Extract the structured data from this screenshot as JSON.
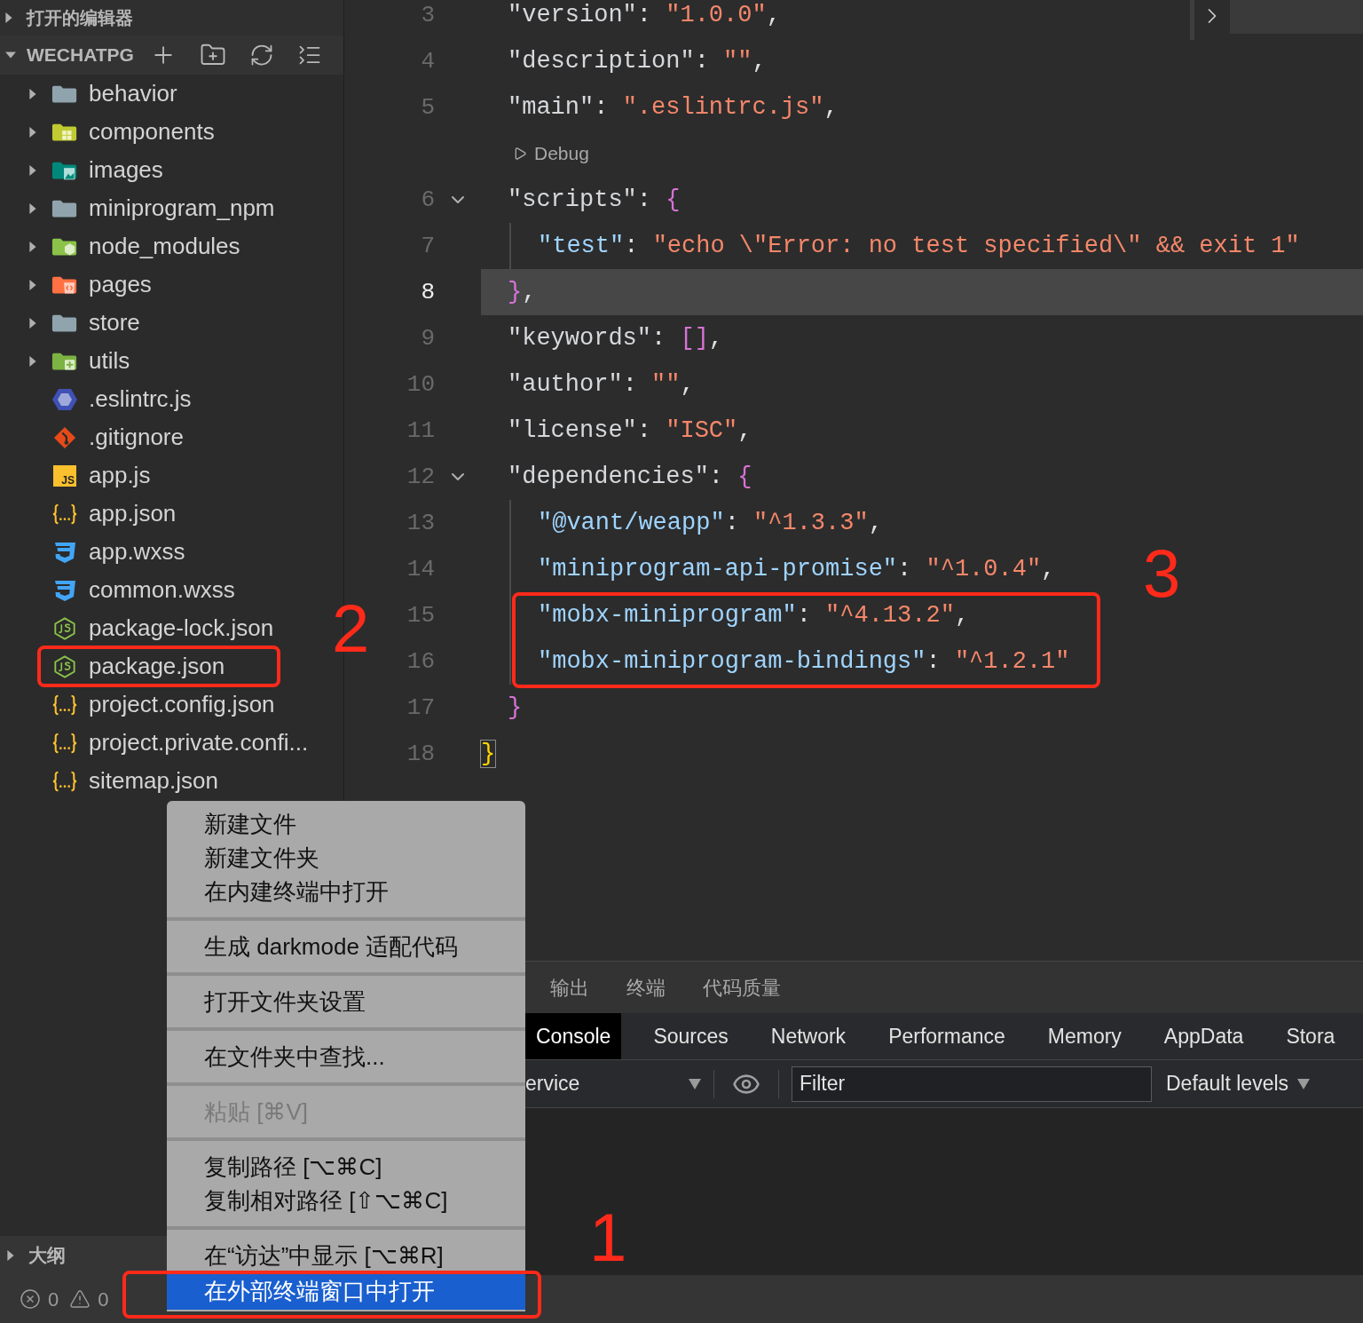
{
  "sidebar": {
    "open_editors": {
      "title": "打开的编辑器",
      "expanded": false
    },
    "explorer": {
      "title": "WECHATPG",
      "expanded": true,
      "items": [
        {
          "name": "behavior",
          "kind": "folder",
          "expanded": false
        },
        {
          "name": "components",
          "kind": "components",
          "expanded": false
        },
        {
          "name": "images",
          "kind": "images",
          "expanded": false
        },
        {
          "name": "miniprogram_npm",
          "kind": "folder",
          "expanded": false
        },
        {
          "name": "node_modules",
          "kind": "modules",
          "expanded": false
        },
        {
          "name": "pages",
          "kind": "pages",
          "expanded": false
        },
        {
          "name": "store",
          "kind": "folder",
          "expanded": false
        },
        {
          "name": "utils",
          "kind": "utils",
          "expanded": false
        },
        {
          "name": ".eslintrc.js",
          "kind": "eslint"
        },
        {
          "name": ".gitignore",
          "kind": "git"
        },
        {
          "name": "app.js",
          "kind": "script",
          "badge": "JS"
        },
        {
          "name": "app.json",
          "kind": "json"
        },
        {
          "name": "app.wxss",
          "kind": "css"
        },
        {
          "name": "common.wxss",
          "kind": "css"
        },
        {
          "name": "package-lock.json",
          "kind": "npm"
        },
        {
          "name": "package.json",
          "kind": "npm"
        },
        {
          "name": "project.config.json",
          "kind": "json"
        },
        {
          "name": "project.private.confi...",
          "kind": "json"
        },
        {
          "name": "sitemap.json",
          "kind": "json"
        }
      ]
    },
    "outline": {
      "title": "大纲",
      "expanded": false
    }
  },
  "editor": {
    "lines": [
      {
        "kind": "code",
        "number": "3",
        "current": false,
        "foldable": false,
        "tokens": [
          {
            "kind": "key",
            "text": "\"version\""
          },
          {
            "kind": "punct",
            "text": ": "
          },
          {
            "kind": "string",
            "text": "\"1.0.0\""
          },
          {
            "kind": "punct",
            "text": ","
          }
        ]
      },
      {
        "kind": "code",
        "number": "4",
        "current": false,
        "foldable": false,
        "tokens": [
          {
            "kind": "key",
            "text": "\"description\""
          },
          {
            "kind": "punct",
            "text": ": "
          },
          {
            "kind": "string",
            "text": "\"\""
          },
          {
            "kind": "punct",
            "text": ","
          }
        ]
      },
      {
        "kind": "code",
        "number": "5",
        "current": false,
        "foldable": false,
        "tokens": [
          {
            "kind": "key",
            "text": "\"main\""
          },
          {
            "kind": "punct",
            "text": ": "
          },
          {
            "kind": "string",
            "text": "\".eslintrc.js\""
          },
          {
            "kind": "punct",
            "text": ","
          }
        ]
      },
      {
        "kind": "codelens",
        "label": "Debug"
      },
      {
        "kind": "code",
        "number": "6",
        "current": false,
        "foldable": true,
        "tokens": [
          {
            "kind": "key",
            "text": "\"scripts\""
          },
          {
            "kind": "punct",
            "text": ": "
          },
          {
            "kind": "brace",
            "text": "{"
          }
        ]
      },
      {
        "kind": "nested",
        "number": "7",
        "current": false,
        "foldable": false,
        "tokens": [
          {
            "kind": "subkey",
            "text": "\"test\""
          },
          {
            "kind": "punct",
            "text": ": "
          },
          {
            "kind": "string",
            "text": "\"echo \\\"Error: no test specified\\\" && exit 1\""
          }
        ]
      },
      {
        "kind": "code",
        "number": "8",
        "current": true,
        "foldable": false,
        "tokens": [
          {
            "kind": "brace",
            "text": "}"
          },
          {
            "kind": "punct",
            "text": ","
          }
        ]
      },
      {
        "kind": "code",
        "number": "9",
        "current": false,
        "foldable": false,
        "tokens": [
          {
            "kind": "key",
            "text": "\"keywords\""
          },
          {
            "kind": "punct",
            "text": ": "
          },
          {
            "kind": "brace",
            "text": "[]"
          },
          {
            "kind": "punct",
            "text": ","
          }
        ]
      },
      {
        "kind": "code",
        "number": "10",
        "current": false,
        "foldable": false,
        "tokens": [
          {
            "kind": "key",
            "text": "\"author\""
          },
          {
            "kind": "punct",
            "text": ": "
          },
          {
            "kind": "string",
            "text": "\"\""
          },
          {
            "kind": "punct",
            "text": ","
          }
        ]
      },
      {
        "kind": "code",
        "number": "11",
        "current": false,
        "foldable": false,
        "tokens": [
          {
            "kind": "key",
            "text": "\"license\""
          },
          {
            "kind": "punct",
            "text": ": "
          },
          {
            "kind": "string",
            "text": "\"ISC\""
          },
          {
            "kind": "punct",
            "text": ","
          }
        ]
      },
      {
        "kind": "code",
        "number": "12",
        "current": false,
        "foldable": true,
        "tokens": [
          {
            "kind": "key",
            "text": "\"dependencies\""
          },
          {
            "kind": "punct",
            "text": ": "
          },
          {
            "kind": "brace",
            "text": "{"
          }
        ]
      },
      {
        "kind": "nested",
        "number": "13",
        "current": false,
        "foldable": false,
        "tokens": [
          {
            "kind": "subkey",
            "text": "\"@vant/weapp\""
          },
          {
            "kind": "punct",
            "text": ": "
          },
          {
            "kind": "string",
            "text": "\"^1.3.3\""
          },
          {
            "kind": "punct",
            "text": ","
          }
        ]
      },
      {
        "kind": "nested",
        "number": "14",
        "current": false,
        "foldable": false,
        "tokens": [
          {
            "kind": "subkey",
            "text": "\"miniprogram-api-promise\""
          },
          {
            "kind": "punct",
            "text": ": "
          },
          {
            "kind": "string",
            "text": "\"^1.0.4\""
          },
          {
            "kind": "punct",
            "text": ","
          }
        ]
      },
      {
        "kind": "nested",
        "number": "15",
        "current": false,
        "foldable": false,
        "tokens": [
          {
            "kind": "subkey",
            "text": "\"mobx-miniprogram\""
          },
          {
            "kind": "punct",
            "text": ": "
          },
          {
            "kind": "string",
            "text": "\"^4.13.2\""
          },
          {
            "kind": "punct",
            "text": ","
          }
        ]
      },
      {
        "kind": "nested",
        "number": "16",
        "current": false,
        "foldable": false,
        "tokens": [
          {
            "kind": "subkey",
            "text": "\"mobx-miniprogram-bindings\""
          },
          {
            "kind": "punct",
            "text": ": "
          },
          {
            "kind": "string",
            "text": "\"^1.2.1\""
          }
        ]
      },
      {
        "kind": "code",
        "number": "17",
        "current": false,
        "foldable": false,
        "tokens": [
          {
            "kind": "brace",
            "text": "}"
          }
        ]
      },
      {
        "kind": "root",
        "number": "18",
        "current": false,
        "foldable": false,
        "tokens": [
          {
            "kind": "match",
            "text": "}"
          }
        ]
      }
    ]
  },
  "panel": {
    "tabs": [
      {
        "label": "输出",
        "selected": false
      },
      {
        "label": "终端",
        "selected": false
      },
      {
        "label": "代码质量",
        "selected": false
      }
    ]
  },
  "devtools": {
    "tabs": [
      {
        "label": "Console",
        "selected": true
      },
      {
        "label": "Sources",
        "selected": false
      },
      {
        "label": "Network",
        "selected": false
      },
      {
        "label": "Performance",
        "selected": false
      },
      {
        "label": "Memory",
        "selected": false
      },
      {
        "label": "AppData",
        "selected": false
      },
      {
        "label": "Stora",
        "selected": false
      }
    ],
    "context": "ervice",
    "filter": {
      "placeholder": "Filter"
    },
    "levels": "Default levels"
  },
  "context_menu": {
    "groups": [
      {
        "items": [
          {
            "label": "新建文件",
            "disabled": false,
            "selected": false
          },
          {
            "label": "新建文件夹",
            "disabled": false,
            "selected": false
          },
          {
            "label": "在内建终端中打开",
            "disabled": false,
            "selected": false
          }
        ]
      },
      {
        "items": [
          {
            "label": "生成 darkmode 适配代码",
            "disabled": false,
            "selected": false
          }
        ]
      },
      {
        "items": [
          {
            "label": "打开文件夹设置",
            "disabled": false,
            "selected": false
          }
        ]
      },
      {
        "items": [
          {
            "label": "在文件夹中查找...",
            "disabled": false,
            "selected": false
          }
        ]
      },
      {
        "items": [
          {
            "label": "粘贴 [⌘V]",
            "disabled": true,
            "selected": false
          }
        ]
      },
      {
        "items": [
          {
            "label": "复制路径 [⌥⌘C]",
            "disabled": false,
            "selected": false
          },
          {
            "label": "复制相对路径 [⇧⌥⌘C]",
            "disabled": false,
            "selected": false
          }
        ]
      },
      {
        "items": [
          {
            "label": "在“访达”中显示 [⌥⌘R]",
            "disabled": false,
            "selected": false
          },
          {
            "label": "在外部终端窗口中打开",
            "disabled": false,
            "selected": true
          }
        ]
      }
    ]
  },
  "annotations": [
    {
      "label": "3"
    },
    {
      "label": "2"
    },
    {
      "label": "1"
    }
  ],
  "status_bar": {
    "errors": "0",
    "warnings": "0"
  }
}
